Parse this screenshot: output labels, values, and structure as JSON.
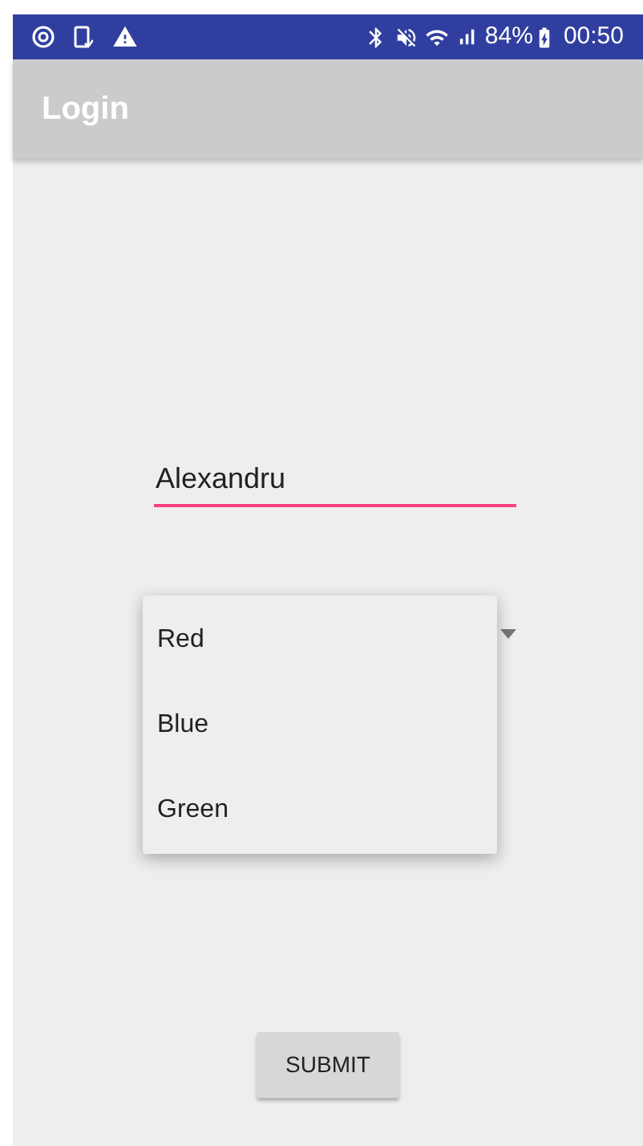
{
  "status_bar": {
    "battery": "84%",
    "time": "00:50"
  },
  "app_bar": {
    "title": "Login"
  },
  "username_field": {
    "value": "Alexandru"
  },
  "color_dropdown": {
    "options": [
      "Red",
      "Blue",
      "Green"
    ]
  },
  "submit_button": {
    "label": "SUBMIT"
  }
}
